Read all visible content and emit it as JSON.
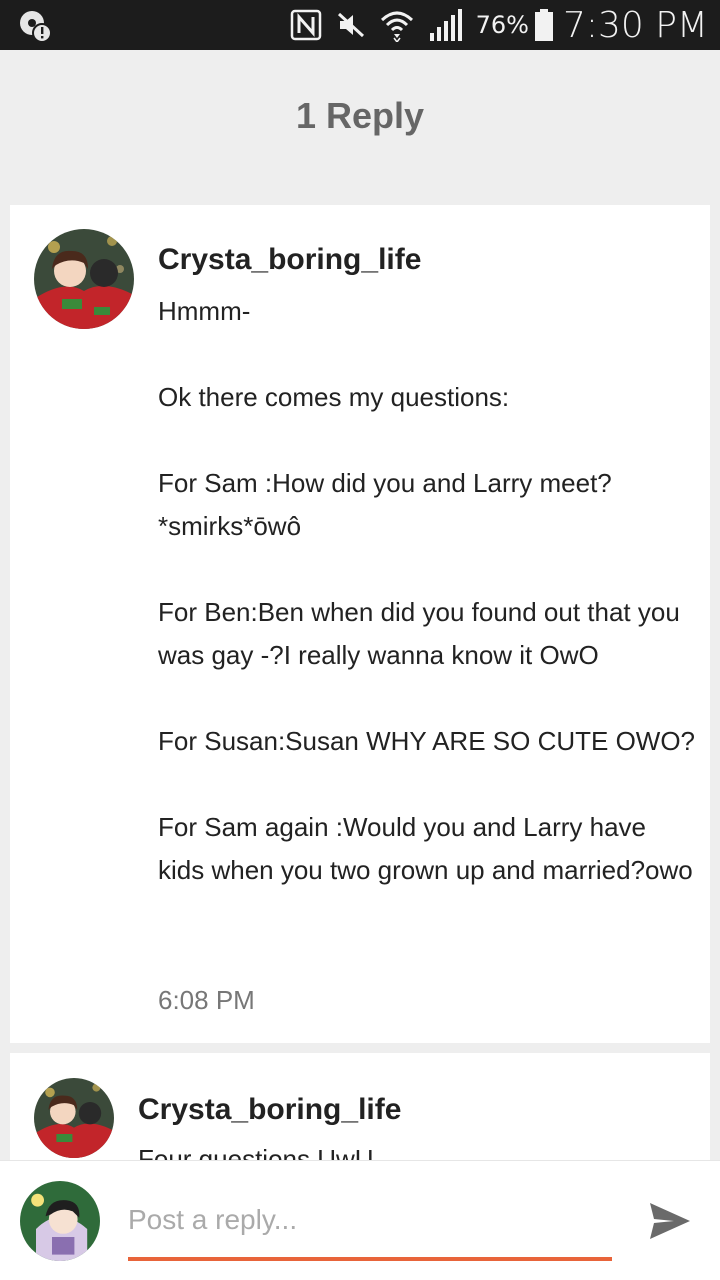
{
  "status_bar": {
    "battery_percent": "76%",
    "time": "7:30 PM"
  },
  "header": {
    "title": "1 Reply"
  },
  "main_comment": {
    "username": "Crysta_boring_life",
    "text": "Hmmm-\n\nOk there comes my questions:\n\nFor Sam :How did you and Larry meet?*smirks*ōwô\n\nFor Ben:Ben when did you found out that you was gay -?I really wanna know it OwO\n\nFor Susan:Susan WHY ARE SO CUTE OWO?\n\nFor Sam again :Would you and Larry have kids when you two grown up and married?owo",
    "timestamp": "6:08 PM"
  },
  "reply_comment": {
    "username": "Crysta_boring_life",
    "text": "Four questions UwU"
  },
  "composer": {
    "placeholder": "Post a reply..."
  },
  "colors": {
    "accent": "#e8643a",
    "status_bar": "#1c1c1c",
    "background": "#eeeeee"
  },
  "icons": {
    "status_left": "notification-alert-icon",
    "nfc": "nfc-icon",
    "mute": "mute-icon",
    "wifi": "wifi-icon",
    "signal": "signal-icon",
    "battery": "battery-icon",
    "send": "send-icon"
  }
}
